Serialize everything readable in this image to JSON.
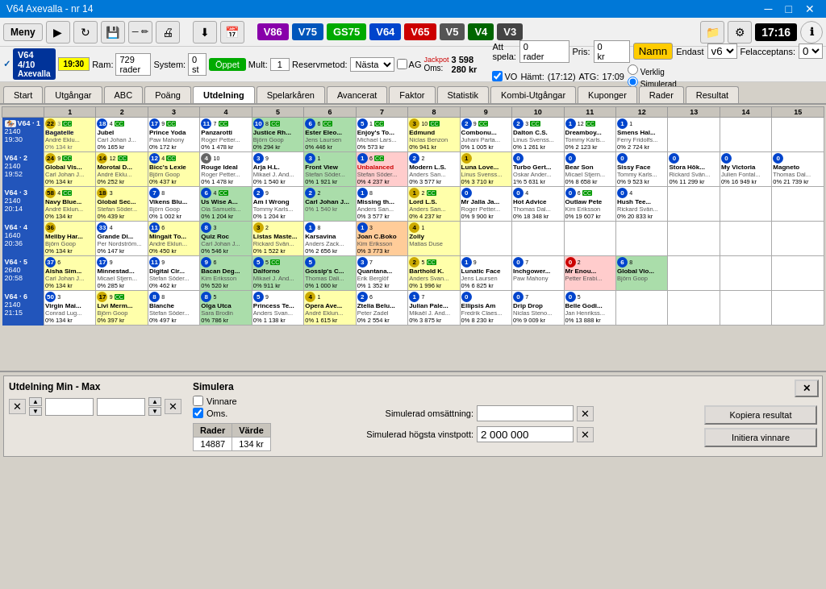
{
  "titleBar": {
    "title": "V64 Axevalla - nr 14",
    "minBtn": "─",
    "maxBtn": "□",
    "closeBtn": "✕"
  },
  "menuBar": {
    "menuLabel": "Meny",
    "playIcon": "▶",
    "refreshIcon": "↻",
    "saveIcon": "💾",
    "editIcon": "✏",
    "printIcon": "🖨",
    "downloadIcon": "⬇",
    "calendarIcon": "📅",
    "versions": [
      "V86",
      "V75",
      "GS75",
      "V64",
      "V65",
      "V5",
      "V4",
      "V3"
    ],
    "fileIcon": "📁",
    "settingsIcon": "⚙",
    "time": "17:16",
    "infoIcon": "ℹ"
  },
  "raceInfo": {
    "checkIcon": "✓",
    "raceBadge": "V64 4/10",
    "raceVenue": "Axevalla",
    "raceTime": "19:30",
    "ramLabel": "Ram:",
    "ramValue": "729 rader",
    "systemLabel": "System:",
    "systemValue": "0 st",
    "openBtn": "Öppet",
    "multLabel": "Mult:",
    "multValue": "1",
    "reservmetodLabel": "Reservmetod:",
    "reservmetodValue": "Nästa",
    "agLabel": "AG",
    "omsLabel": "Oms:",
    "jackpotLabel": "Jackpot",
    "omsValue": "3 598 280 kr",
    "attSpelaLabel": "Att spela:",
    "attSpelaValue": "0 rader",
    "prisLabel": "Pris:",
    "prisValue": "0 kr",
    "namnBtn": "Namn",
    "endastLabel": "Endast",
    "endastValue": "v6",
    "felaccLabel": "Felacceptans:",
    "felaccValue": "0",
    "voLabel": "VO",
    "hamtLabel": "Hämt:",
    "hamtValue": "(17:12)",
    "atgLabel": "ATG:",
    "atgValue": "17:09",
    "verkligLabel": "Verklig",
    "simuleradLabel": "Simulerad"
  },
  "navTabs": [
    "Start",
    "Utgångar",
    "ABC",
    "Poäng",
    "Utdelning",
    "Spelarkåren",
    "Avancerat",
    "Faktor",
    "Statistik",
    "Kombi-Utgångar",
    "Kuponger",
    "Rader",
    "Resultat"
  ],
  "activeTab": "Utdelning",
  "colHeaders": [
    "",
    "1",
    "2",
    "3",
    "4",
    "5",
    "6",
    "7",
    "8",
    "9",
    "10",
    "11",
    "12",
    "13",
    "14",
    "15"
  ],
  "races": [
    {
      "id": "V64-1",
      "label": "V64 · 1",
      "subLabel": "2140",
      "time": "19:30",
      "color": "#2255bb",
      "horses": [
        {
          "num": 22,
          "numColor": "nc-yellow",
          "badges": [
            "3",
            "cc"
          ],
          "name": "Bagatelle",
          "jockey": "André Eklu...",
          "pct": "0%",
          "kr": "134 kr",
          "bg": ""
        },
        {
          "num": 18,
          "numColor": "nc-blue",
          "badges": [
            "4",
            "cc"
          ],
          "name": "Jubel",
          "jockey": "Carl Johan J...",
          "pct": "0%",
          "kr": "165 kr",
          "bg": ""
        },
        {
          "num": 17,
          "numColor": "nc-blue",
          "badges": [
            "9",
            "cc"
          ],
          "name": "Prince Yoda",
          "jockey": "Paw Mahony",
          "pct": "0%",
          "kr": "172 kr",
          "bg": ""
        },
        {
          "num": 11,
          "numColor": "nc-blue",
          "badges": [
            "7",
            "cc"
          ],
          "name": "Panzarotti",
          "jockey": "Roger Petter...",
          "pct": "0%",
          "kr": "1 478 kr",
          "bg": ""
        },
        {
          "num": 10,
          "numColor": "nc-blue",
          "badges": [
            "8",
            "cc"
          ],
          "name": "Justice Rh...",
          "jockey": "Björn Goop",
          "pct": "0%",
          "kr": "294 kr",
          "bg": "sel"
        },
        {
          "num": 6,
          "numColor": "nc-blue",
          "badges": [
            "6",
            "cc"
          ],
          "name": "Ester Eleo...",
          "jockey": "Jens Laursen",
          "pct": "0%",
          "kr": "446 kr",
          "bg": "sel"
        },
        {
          "num": 5,
          "numColor": "nc-blue",
          "badges": [
            "1",
            "cc"
          ],
          "name": "Enjoy's To...",
          "jockey": "Michael Lars...",
          "pct": "0%",
          "kr": "573 kr",
          "bg": ""
        },
        {
          "num": 3,
          "numColor": "nc-yellow",
          "badges": [
            "10",
            "cc"
          ],
          "name": "Edmund",
          "jockey": "Niclas Benzon",
          "pct": "0%",
          "kr": "941 kr",
          "bg": "hi"
        },
        {
          "num": 2,
          "numColor": "nc-blue",
          "badges": [
            "9",
            "cc"
          ],
          "name": "Combonu...",
          "jockey": "Juhani Parta...",
          "pct": "0%",
          "kr": "1 005 kr",
          "bg": ""
        },
        {
          "num": 2,
          "numColor": "nc-blue",
          "badges": [
            "3",
            "cc"
          ],
          "name": "Dalton C.S.",
          "jockey": "Linus Svenss...",
          "pct": "0%",
          "kr": "1 261 kr",
          "bg": ""
        },
        {
          "num": 1,
          "numColor": "nc-blue",
          "badges": [
            "12",
            "cc"
          ],
          "name": "Dreamboy...",
          "jockey": "Tommy Karls...",
          "pct": "0%",
          "kr": "2 123 kr",
          "bg": ""
        },
        {
          "num": 1,
          "numColor": "nc-blue",
          "badges": [
            "1"
          ],
          "name": "Smens Hal...",
          "jockey": "Ferry Fridolfs...",
          "pct": "0%",
          "kr": "2 724 kr",
          "bg": ""
        }
      ]
    },
    {
      "id": "V64-2",
      "label": "V64 · 2",
      "subLabel": "2140",
      "time": "19:52",
      "color": "#2255bb"
    },
    {
      "id": "V64-3",
      "label": "V64 · 3",
      "subLabel": "2140",
      "time": "20:14",
      "color": "#2255bb"
    },
    {
      "id": "V64-4",
      "label": "V64 · 4",
      "subLabel": "1640",
      "time": "20:36",
      "color": "#2255bb"
    },
    {
      "id": "V64-5",
      "label": "V64 · 5",
      "subLabel": "2640",
      "time": "20:58",
      "color": "#2255bb"
    },
    {
      "id": "V64-6",
      "label": "V64 · 6",
      "subLabel": "2140",
      "time": "21:15",
      "color": "#2255bb"
    }
  ],
  "bottomPanel": {
    "utdelningTitle": "Utdelning Min - Max",
    "closeBtn": "✕",
    "kopieraBtn": "Kopiera resultat",
    "initieraBtn": "Initiera vinnare",
    "simulera": {
      "title": "Simulera",
      "vinnareLabel": "Vinnare",
      "omsLabel": "Oms.",
      "omsChecked": true,
      "vinnareChecked": false
    },
    "simTable": {
      "headers": [
        "Rader",
        "Värde"
      ],
      "row": [
        "14887",
        "134 kr"
      ]
    },
    "simFields": {
      "omsattningLabel": "Simulerad omsättning:",
      "vinstpottLabel": "Simulerad högsta vinstpott:",
      "vinstpottValue": "2 000 000"
    }
  },
  "unbalanced": {
    "text": "Unbalanced",
    "position": {
      "col": 8,
      "row": 2
    }
  }
}
